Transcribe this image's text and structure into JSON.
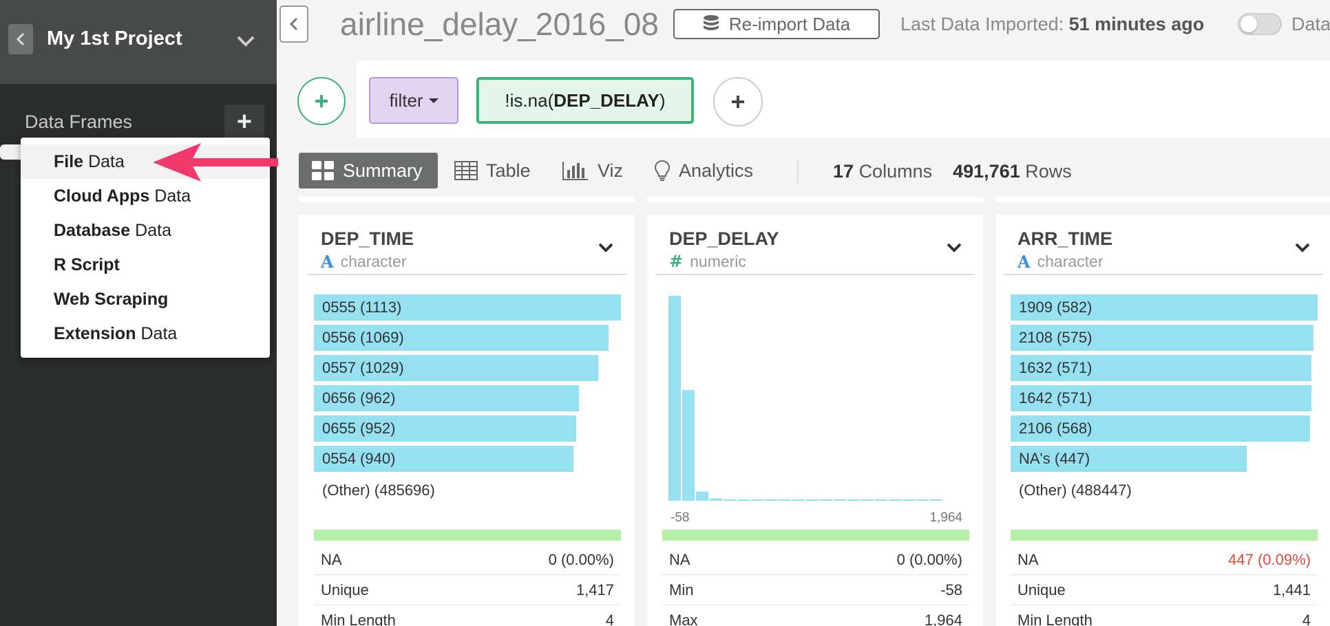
{
  "sidebar": {
    "project_title": "My 1st Project",
    "data_frames_label": "Data Frames",
    "add_label": "+"
  },
  "menu": {
    "items": [
      {
        "bold": "File",
        "rest": "Data"
      },
      {
        "bold": "Cloud Apps",
        "rest": "Data"
      },
      {
        "bold": "Database",
        "rest": "Data"
      },
      {
        "bold": "R Script",
        "rest": ""
      },
      {
        "bold": "Web Scraping",
        "rest": ""
      },
      {
        "bold": "Extension",
        "rest": "Data"
      }
    ]
  },
  "header": {
    "dataset_title": "airline_delay_2016_08",
    "reimport_label": "Re-import Data",
    "last_imported_label": "Last Data Imported:",
    "last_imported_value": "51 minutes ago",
    "toggle_label": "Data"
  },
  "steps": {
    "filter_label": "filter",
    "condition_prefix": "!is.na(",
    "condition_column": "DEP_DELAY",
    "condition_suffix": ")"
  },
  "tabs": {
    "summary": "Summary",
    "table": "Table",
    "viz": "Viz",
    "analytics": "Analytics"
  },
  "counts": {
    "columns_value": "17",
    "columns_label": "Columns",
    "rows_value": "491,761",
    "rows_label": "Rows"
  },
  "cards": [
    {
      "name": "DEP_TIME",
      "type": "character",
      "bars": [
        {
          "label": "0555 (1113)",
          "frac": 1.0
        },
        {
          "label": "0556 (1069)",
          "frac": 0.96
        },
        {
          "label": "0557 (1029)",
          "frac": 0.925
        },
        {
          "label": "0656 (962)",
          "frac": 0.864
        },
        {
          "label": "0655 (952)",
          "frac": 0.855
        },
        {
          "label": "0554 (940)",
          "frac": 0.845
        }
      ],
      "other": "(Other) (485696)",
      "stats": [
        {
          "label": "NA",
          "value": "0 (0.00%)",
          "warn": false
        },
        {
          "label": "Unique",
          "value": "1,417",
          "warn": false
        },
        {
          "label": "Min Length",
          "value": "4",
          "warn": false
        }
      ]
    },
    {
      "name": "DEP_DELAY",
      "type": "numeric",
      "histogram": [
        1.0,
        0.54,
        0.045,
        0.012,
        0.006,
        0.005,
        0.004,
        0.004,
        0.004,
        0.003,
        0.003,
        0.003,
        0.003,
        0.003,
        0.003,
        0.003,
        0.003,
        0.003,
        0.003,
        0.003
      ],
      "x_min_label": "-58",
      "x_max_label": "1,964",
      "stats": [
        {
          "label": "NA",
          "value": "0 (0.00%)",
          "warn": false
        },
        {
          "label": "Min",
          "value": "-58",
          "warn": false
        },
        {
          "label": "Max",
          "value": "1,964",
          "warn": false
        }
      ]
    },
    {
      "name": "ARR_TIME",
      "type": "character",
      "bars": [
        {
          "label": "1909 (582)",
          "frac": 1.0
        },
        {
          "label": "2108 (575)",
          "frac": 0.987
        },
        {
          "label": "1632 (571)",
          "frac": 0.98
        },
        {
          "label": "1642 (571)",
          "frac": 0.98
        },
        {
          "label": "2106 (568)",
          "frac": 0.975
        },
        {
          "label": "NA's (447)",
          "frac": 0.768
        }
      ],
      "other": "(Other) (488447)",
      "stats": [
        {
          "label": "NA",
          "value": "447 (0.09%)",
          "warn": true
        },
        {
          "label": "Unique",
          "value": "1,441",
          "warn": false
        },
        {
          "label": "Min Length",
          "value": "4",
          "warn": false
        }
      ]
    }
  ],
  "colors": {
    "bar": "#95e1f2",
    "accent_green": "#3bb27a",
    "warn_red": "#e04a3b",
    "arrow_pink": "#f0386b"
  }
}
